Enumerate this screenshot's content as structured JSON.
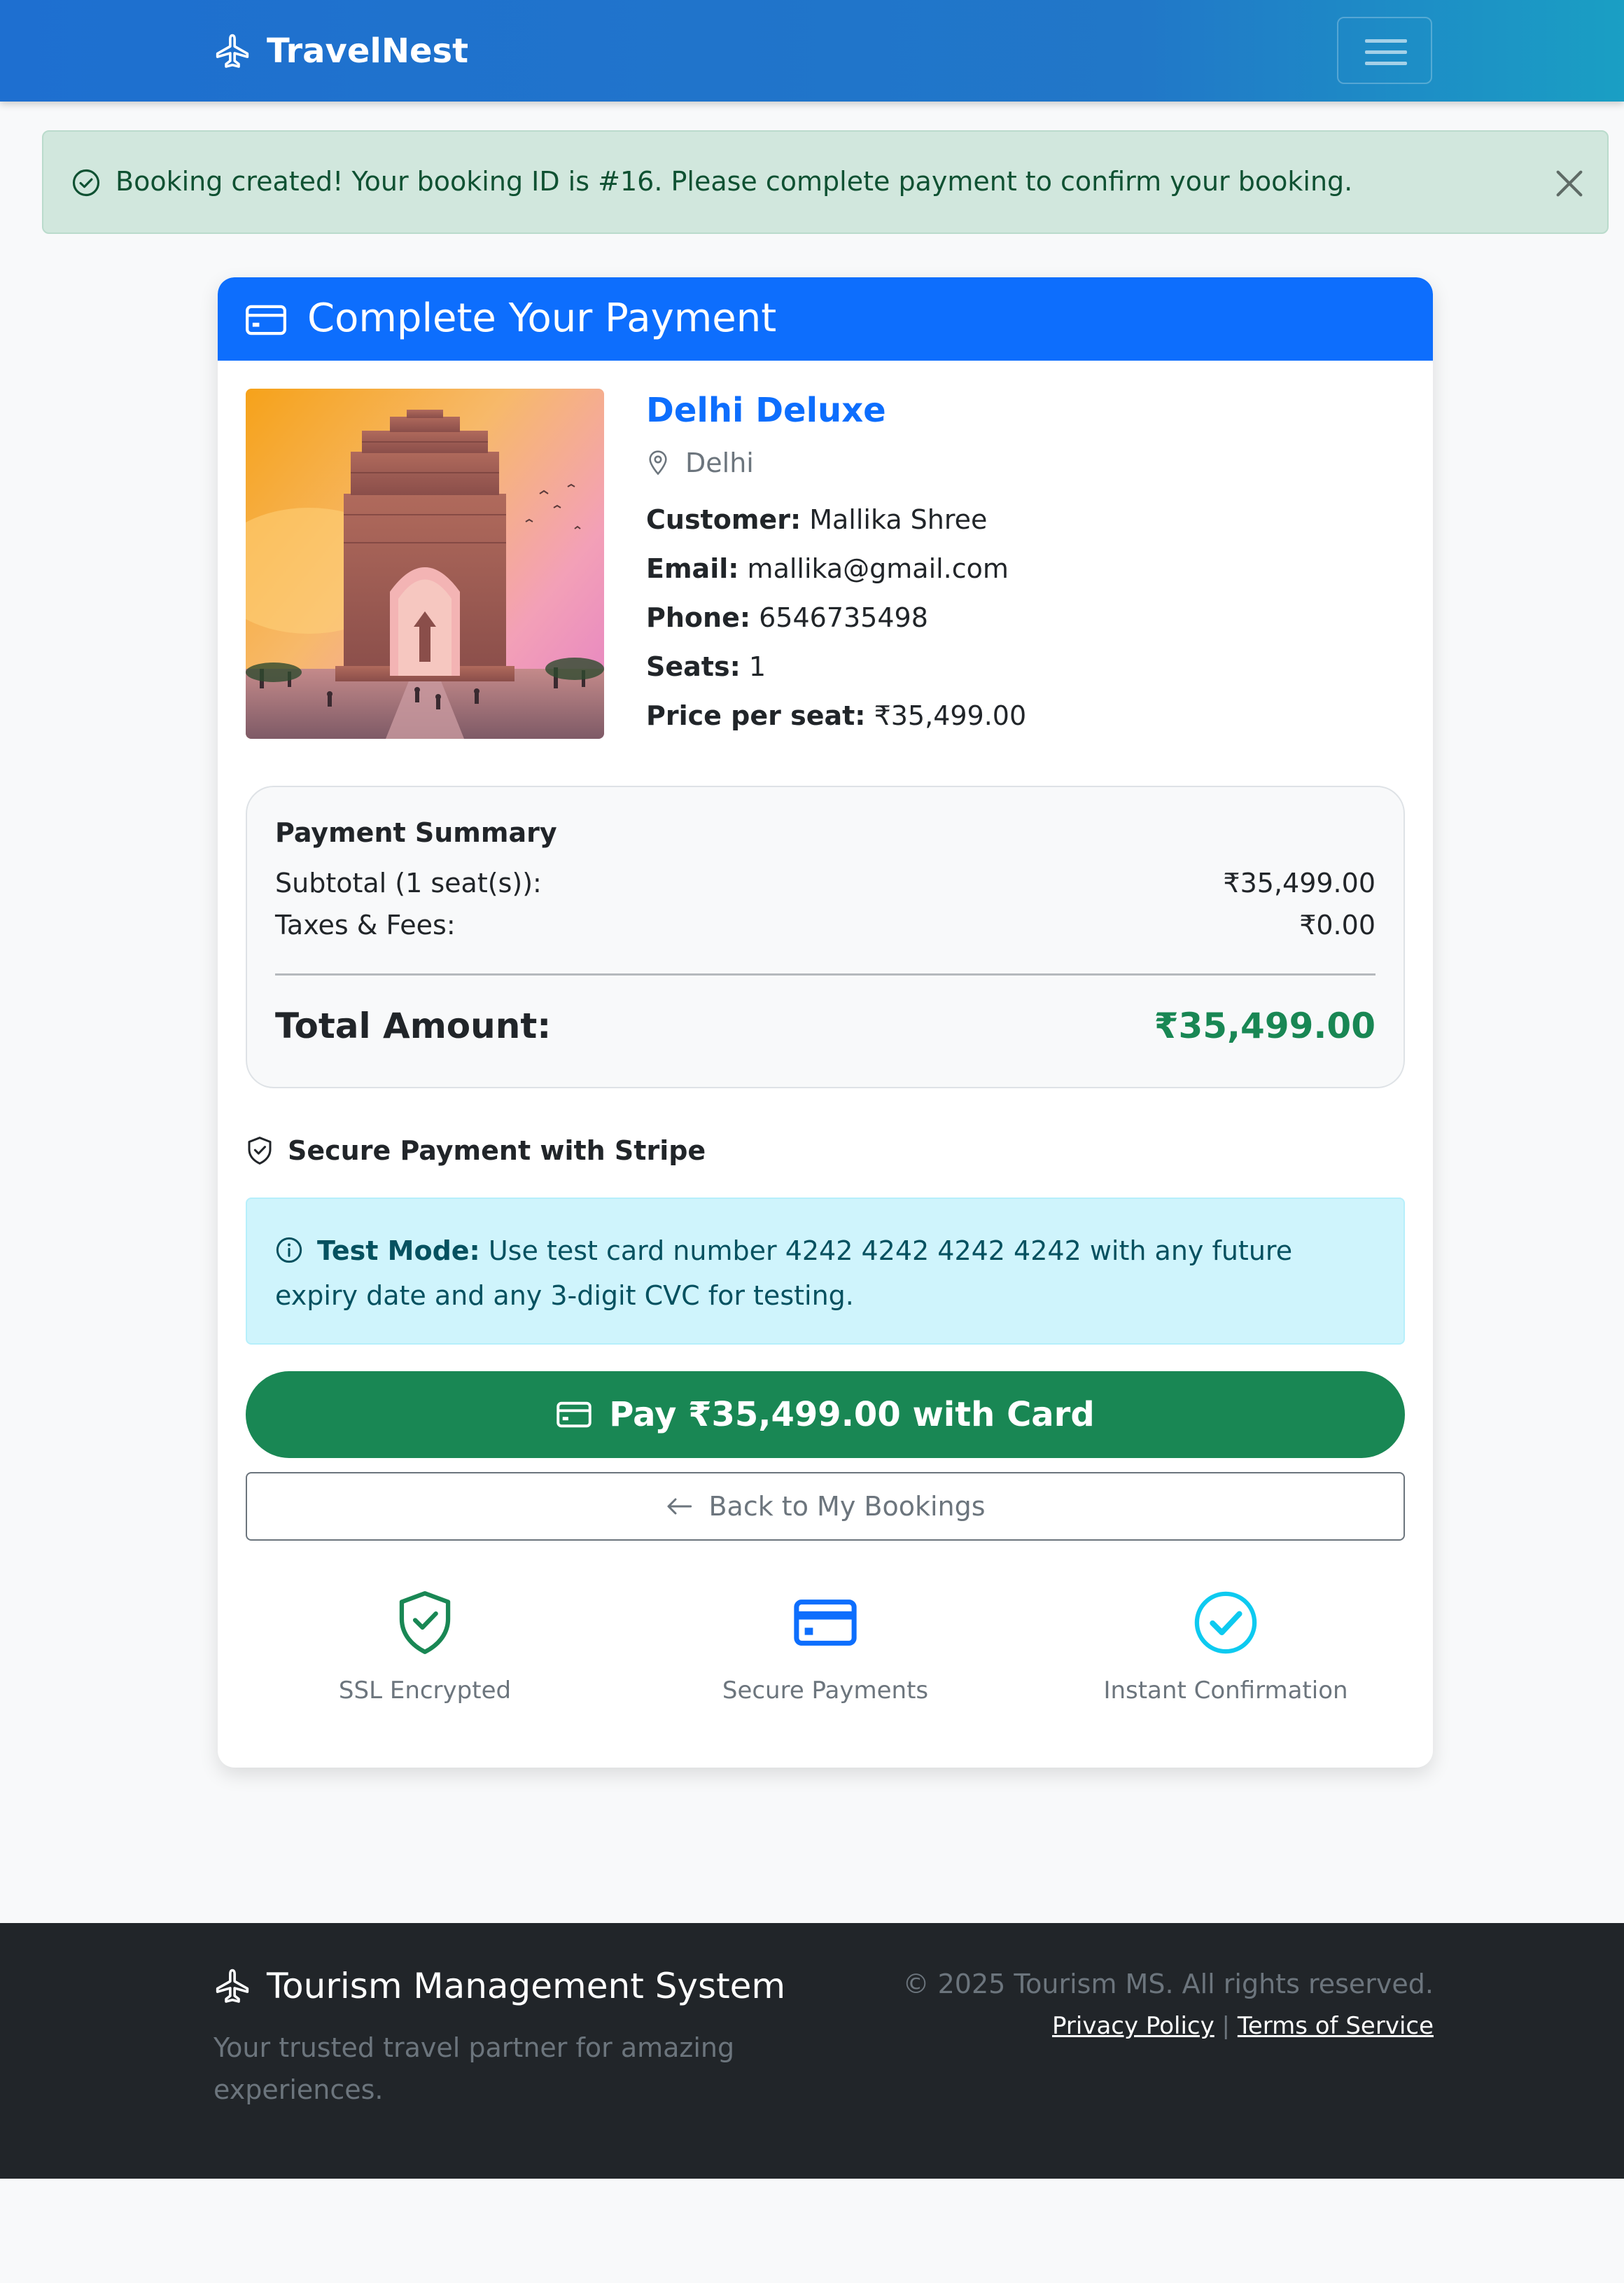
{
  "navbar": {
    "brand": "TravelNest",
    "brand_icon": "airplane-icon",
    "menu_icon": "hamburger-icon"
  },
  "alert": {
    "icon": "check-circle-icon",
    "message": "Booking created! Your booking ID is #16. Please complete payment to confirm your booking.",
    "close_icon": "close-icon"
  },
  "card": {
    "title": "Complete Your Payment",
    "title_icon": "credit-card-icon",
    "package": {
      "name": "Delhi Deluxe",
      "location": "Delhi",
      "location_icon": "map-pin-icon",
      "customer_label": "Customer:",
      "customer": "Mallika Shree",
      "email_label": "Email:",
      "email": "mallika@gmail.com",
      "phone_label": "Phone:",
      "phone": "6546735498",
      "seats_label": "Seats:",
      "seats": "1",
      "price_label": "Price per seat:",
      "price": "₹35,499.00"
    },
    "summary": {
      "title": "Payment Summary",
      "subtotal_label": "Subtotal (1 seat(s)):",
      "subtotal": "₹35,499.00",
      "taxes_label": "Taxes & Fees:",
      "taxes": "₹0.00",
      "total_label": "Total Amount:",
      "total": "₹35,499.00"
    },
    "secure_title": "Secure Payment with Stripe",
    "secure_icon": "shield-check-icon",
    "test_mode": {
      "label": "Test Mode:",
      "text": "Use test card number 4242 4242 4242 4242 with any future expiry date and any 3-digit CVC for testing.",
      "icon": "info-circle-icon"
    },
    "pay_button": "Pay ₹35,499.00 with Card",
    "back_button": "Back to My Bookings",
    "features": [
      {
        "label": "SSL Encrypted",
        "icon": "shield-check-icon"
      },
      {
        "label": "Secure Payments",
        "icon": "credit-card-icon"
      },
      {
        "label": "Instant Confirmation",
        "icon": "check-circle-icon"
      }
    ]
  },
  "colors": {
    "primary": "#0d6efd",
    "success": "#198754",
    "info_bg": "#cff4fc",
    "alert_bg": "#d1e7dd",
    "footer_bg": "#212529",
    "feature_ssl": "#198754",
    "feature_card": "#0d6efd",
    "feature_check": "#0dcaf0"
  },
  "footer": {
    "title": "Tourism Management System",
    "tagline": "Your trusted travel partner for amazing experiences.",
    "copyright": "© 2025 Tourism MS. All rights reserved.",
    "privacy": "Privacy Policy",
    "separator": "|",
    "terms": "Terms of Service"
  }
}
